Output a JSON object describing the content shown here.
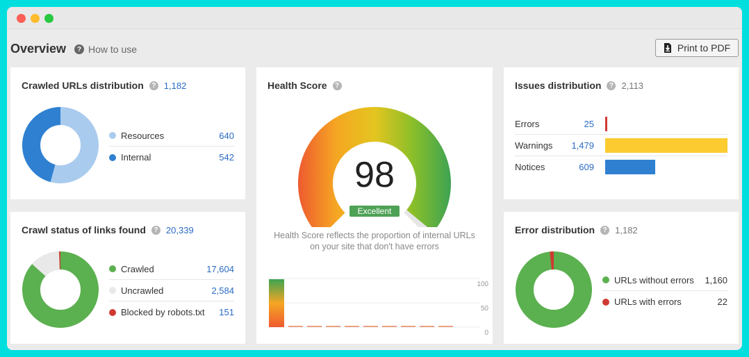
{
  "header": {
    "title": "Overview",
    "how_to_use": "How to use",
    "print_label": "Print to PDF"
  },
  "crawled_urls": {
    "title": "Crawled URLs distribution",
    "total": "1,182",
    "items": [
      {
        "label": "Resources",
        "value": "640",
        "color": "#a9cbee"
      },
      {
        "label": "Internal",
        "value": "542",
        "color": "#2f80d1"
      }
    ]
  },
  "crawl_status": {
    "title": "Crawl status of links found",
    "total": "20,339",
    "items": [
      {
        "label": "Crawled",
        "value": "17,604",
        "color": "#5bb04f"
      },
      {
        "label": "Uncrawled",
        "value": "2,584",
        "color": "#e9e9e9"
      },
      {
        "label": "Blocked by robots.txt",
        "value": "151",
        "color": "#cf3a32"
      }
    ]
  },
  "health": {
    "title": "Health Score",
    "score": "98",
    "rating": "Excellent",
    "description": "Health Score reflects the proportion of internal URLs on your site that don't have errors",
    "axis": [
      "100",
      "50",
      "0"
    ]
  },
  "issues": {
    "title": "Issues distribution",
    "total": "2,113",
    "items": [
      {
        "label": "Errors",
        "value": "25",
        "color": "#d13b32"
      },
      {
        "label": "Warnings",
        "value": "1,479",
        "color": "#fbcb30"
      },
      {
        "label": "Notices",
        "value": "609",
        "color": "#2f80d1"
      }
    ]
  },
  "errors": {
    "title": "Error distribution",
    "total": "1,182",
    "items": [
      {
        "label": "URLs without errors",
        "value": "1,160",
        "color": "#5bb04f"
      },
      {
        "label": "URLs with errors",
        "value": "22",
        "color": "#cf3a32"
      }
    ]
  }
}
